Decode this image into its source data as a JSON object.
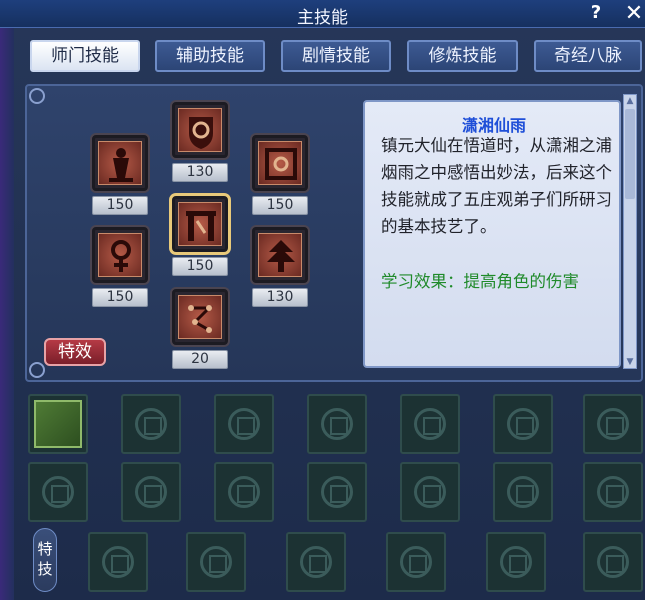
{
  "window": {
    "title": "主技能",
    "help_label": "?",
    "close_label": "✕"
  },
  "tabs": [
    {
      "label": "师门技能",
      "active": true
    },
    {
      "label": "辅助技能"
    },
    {
      "label": "剧情技能"
    },
    {
      "label": "修炼技能"
    },
    {
      "label": "奇经八脉"
    }
  ],
  "skills": [
    {
      "icon": "shield-swirl-icon",
      "level": "130"
    },
    {
      "icon": "warrior-icon",
      "level": "150"
    },
    {
      "icon": "square-seal-icon",
      "level": "150"
    },
    {
      "icon": "pillar-gate-icon",
      "level": "150",
      "selected": true
    },
    {
      "icon": "female-symbol-icon",
      "level": "150"
    },
    {
      "icon": "tree-icon",
      "level": "130"
    },
    {
      "icon": "constellation-icon",
      "level": "20"
    }
  ],
  "effect_button": "特效",
  "description": {
    "title": "潇湘仙雨",
    "body": "镇元大仙在悟道时，从潇湘之浦烟雨之中感悟出妙法，后来这个技能就成了五庄观弟子们所研习的基本技艺了。",
    "effect": "学习效果：提高角色的伤害"
  },
  "special_tab": "特技",
  "colors": {
    "accent_blue": "#1f4fd8",
    "effect_green": "#1f8a2a",
    "effect_red": "#9b2834"
  }
}
